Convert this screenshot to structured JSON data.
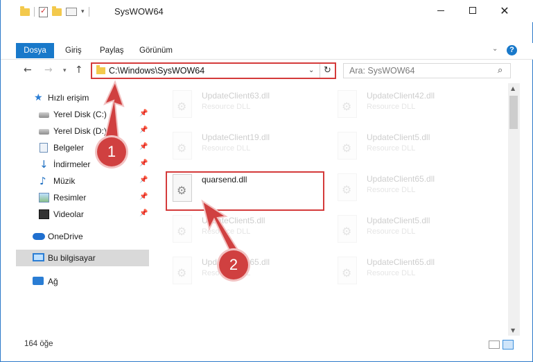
{
  "window": {
    "title": "SysWOW64",
    "controls": [
      "minimize",
      "maximize",
      "close"
    ]
  },
  "ribbon": {
    "tabs": [
      {
        "label": "Dosya",
        "active": true
      },
      {
        "label": "Giriş"
      },
      {
        "label": "Paylaş"
      },
      {
        "label": "Görünüm"
      }
    ],
    "help": "?"
  },
  "nav": {
    "address": "C:\\Windows\\SysWOW64",
    "search_placeholder": "Ara: SysWOW64"
  },
  "sidebar": {
    "items": [
      {
        "label": "Hızlı erişim",
        "icon": "star-icon"
      },
      {
        "label": "Yerel Disk (C:)",
        "icon": "disk-icon",
        "pinned": true
      },
      {
        "label": "Yerel Disk (D:)",
        "icon": "disk-icon",
        "pinned": true
      },
      {
        "label": "Belgeler",
        "icon": "documents-icon",
        "pinned": true
      },
      {
        "label": "İndirmeler",
        "icon": "download-icon",
        "pinned": true
      },
      {
        "label": "Müzik",
        "icon": "music-icon",
        "pinned": true
      },
      {
        "label": "Resimler",
        "icon": "pictures-icon",
        "pinned": true
      },
      {
        "label": "Videolar",
        "icon": "videos-icon",
        "pinned": true
      },
      {
        "label": "OneDrive",
        "icon": "onedrive-icon"
      },
      {
        "label": "Bu bilgisayar",
        "icon": "computer-icon",
        "selected": true
      },
      {
        "label": "Ağ",
        "icon": "network-icon"
      }
    ]
  },
  "files": [
    {
      "name": "UpdateClient63.dll",
      "type": "Resource DLL",
      "faded": true
    },
    {
      "name": "UpdateClient42.dll",
      "type": "Resource DLL",
      "faded": true
    },
    {
      "name": "UpdateClient19.dll",
      "type": "Resource DLL",
      "faded": true
    },
    {
      "name": "UpdateClient5.dll",
      "type": "Resource DLL",
      "faded": true
    },
    {
      "name": "quarsend.dll",
      "type": "",
      "faded": false
    },
    {
      "name": "UpdateClient65.dll",
      "type": "Resource DLL",
      "faded": true
    },
    {
      "name": "UpdateClient5.dll",
      "type": "Resource DLL",
      "faded": true
    },
    {
      "name": "UpdateClient5.dll",
      "type": "Resource DLL",
      "faded": true
    },
    {
      "name": "UpdateClient65.dll",
      "type": "Resource DLL",
      "faded": true
    },
    {
      "name": "UpdateClient65.dll",
      "type": "Resource DLL",
      "faded": true
    }
  ],
  "status": {
    "count": "164 öğe"
  },
  "annotations": {
    "step1": "1",
    "step2": "2",
    "accent_color": "#d04040"
  }
}
